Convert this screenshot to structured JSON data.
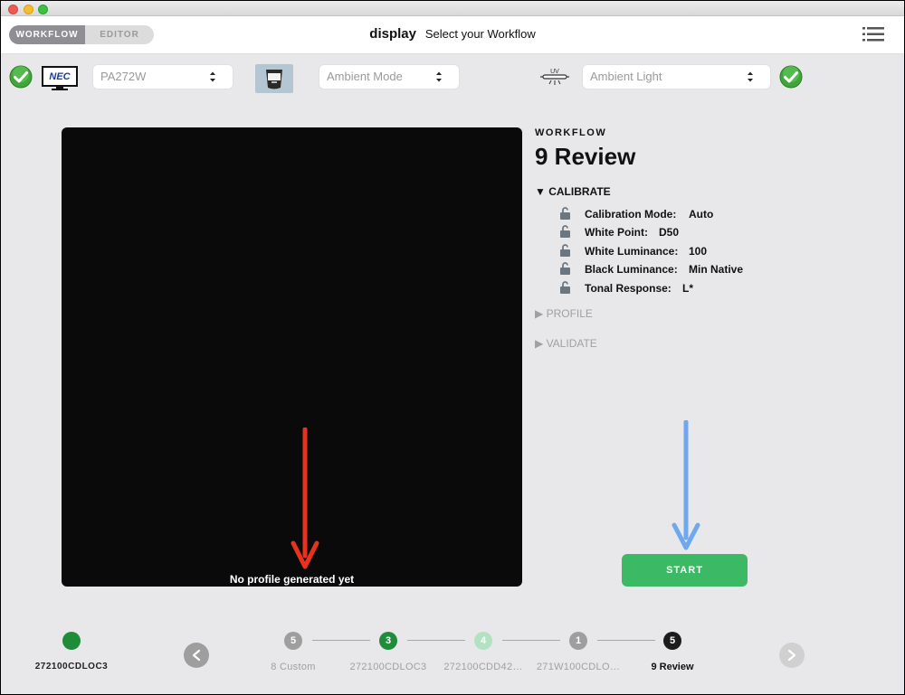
{
  "header": {
    "tabs": [
      {
        "label": "WORKFLOW"
      },
      {
        "label": "EDITOR"
      }
    ],
    "app_name": "display",
    "subtitle": "Select your Workflow"
  },
  "device_bar": {
    "display_model": "PA272W",
    "mode_select": "Ambient Mode",
    "light_select": "Ambient Light",
    "uv_label": "UV"
  },
  "preview": {
    "message": "No profile generated yet"
  },
  "workflow": {
    "label": "WORKFLOW",
    "title": "9 Review",
    "calibrate_head": "▼ CALIBRATE",
    "params": [
      {
        "label": "Calibration Mode:",
        "value": "Auto"
      },
      {
        "label": "White Point:",
        "value": "D50"
      },
      {
        "label": "White Luminance:",
        "value": "100"
      },
      {
        "label": "Black Luminance:",
        "value": "Min Native"
      },
      {
        "label": "Tonal Response:",
        "value": "L*"
      }
    ],
    "profile_head": "▶ PROFILE",
    "validate_head": "▶ VALIDATE",
    "start_label": "START"
  },
  "stepper": {
    "current_name": "272100CDLOC3",
    "steps": [
      {
        "number": "5",
        "label": "8 Custom",
        "color": "#9e9e9e"
      },
      {
        "number": "3",
        "label": "272100CDLOC3",
        "color": "#1f8c3a"
      },
      {
        "number": "4",
        "label": "272100CDD42…",
        "color": "#b3e2c3"
      },
      {
        "number": "1",
        "label": "271W100CDLO…",
        "color": "#9e9e9e"
      },
      {
        "number": "5",
        "label": "9 Review",
        "color": "#1c1c1c"
      }
    ]
  },
  "colors": {
    "accent_green": "#3cb964",
    "annotation_red": "#e8321f",
    "annotation_blue": "#6fa8ee"
  }
}
